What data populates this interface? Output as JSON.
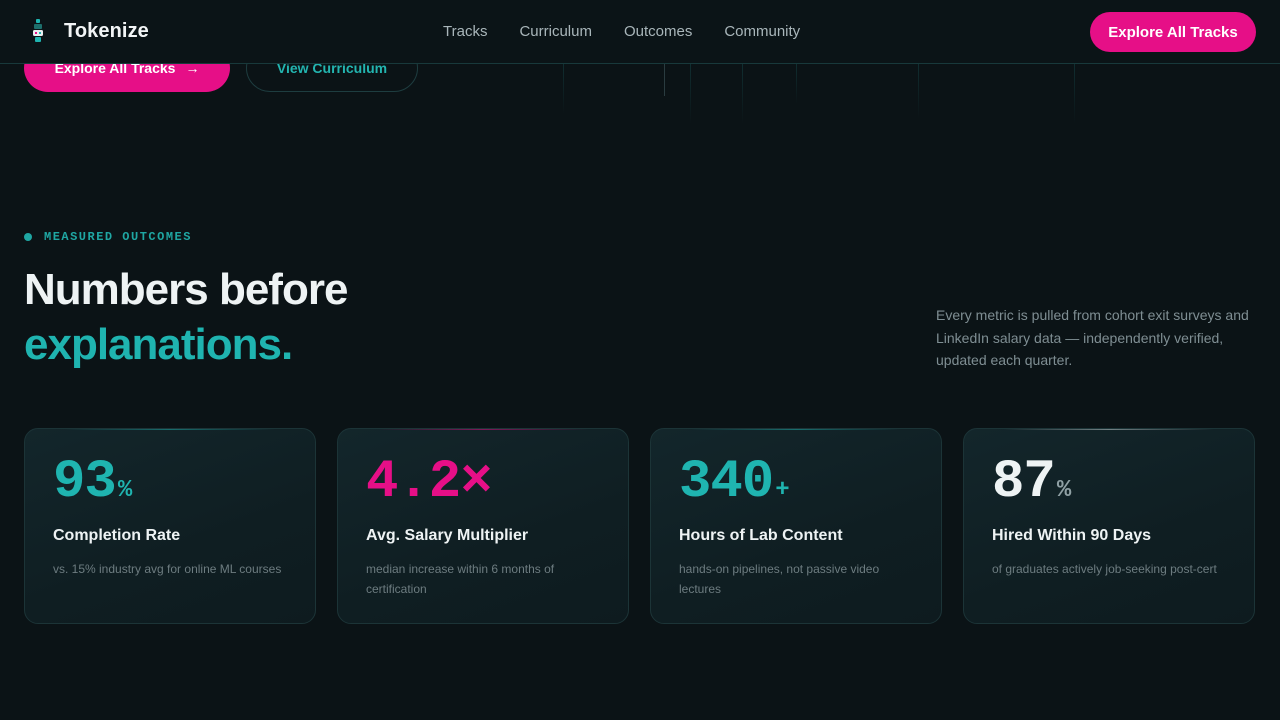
{
  "colors": {
    "accent_pink": "#e60f87",
    "accent_teal": "#1fb4b0",
    "background": "#0b1316",
    "white": "#eef3f4"
  },
  "nav": {
    "brand_icon": "tokenize-logo-icon",
    "brand_name": "Tokenize",
    "links": [
      "Tracks",
      "Curriculum",
      "Outcomes",
      "Community"
    ],
    "cta_label": "Explore All Tracks"
  },
  "hero": {
    "primary_label": "Explore All Tracks",
    "primary_icon": "arrow-right-icon",
    "secondary_label": "View Curriculum"
  },
  "outcomes": {
    "eyebrow": "MEASURED OUTCOMES",
    "headline_line1": "Numbers before",
    "headline_line2": "explanations.",
    "description": "Every metric is pulled from cohort exit surveys and LinkedIn salary data — independently verified, updated each quarter.",
    "stats": [
      {
        "value": "93",
        "suffix": "%",
        "color": "#1fb4b0",
        "label": "Completion Rate",
        "note": "vs. 15% industry avg for online ML courses"
      },
      {
        "value": "4.2×",
        "suffix": "",
        "color": "#e60f87",
        "label": "Avg. Salary Multiplier",
        "note": "median increase within 6 months of certification"
      },
      {
        "value": "340",
        "suffix": "+",
        "color": "#1fb4b0",
        "label": "Hours of Lab Content",
        "note": "hands-on pipelines, not passive video lectures"
      },
      {
        "value": "87",
        "suffix": "%",
        "color": "#eef3f4",
        "label": "Hired Within 90 Days",
        "note": "of graduates actively job-seeking post-cert"
      }
    ]
  }
}
